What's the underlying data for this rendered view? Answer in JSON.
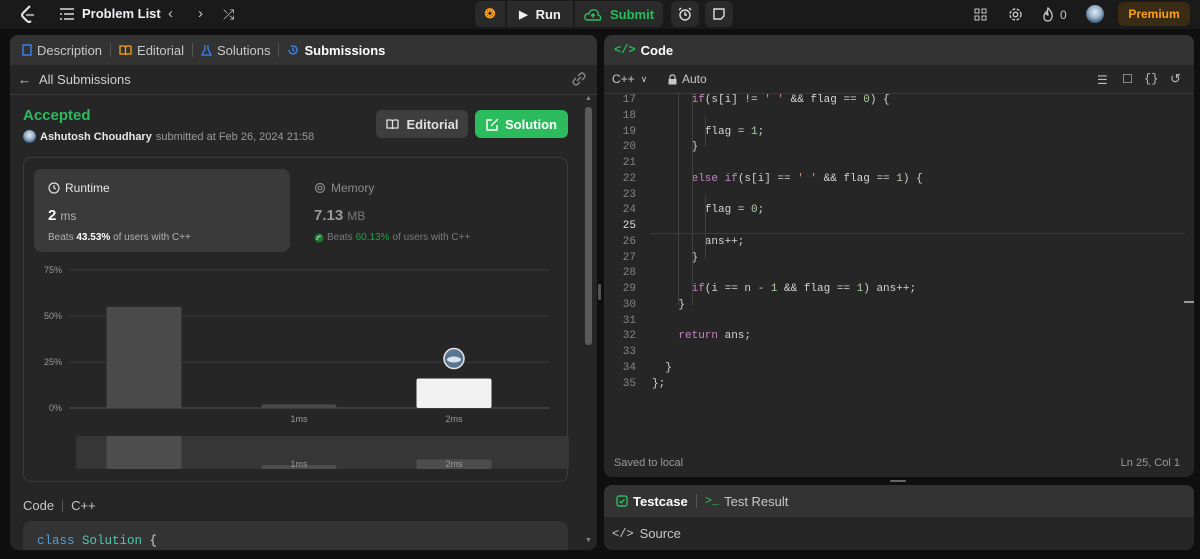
{
  "topbar": {
    "problem_list": "Problem List",
    "run": "Run",
    "submit": "Submit",
    "streak": "0",
    "premium": "Premium"
  },
  "left": {
    "tabs": [
      "Description",
      "Editorial",
      "Solutions",
      "Submissions"
    ],
    "back_label": "All Submissions",
    "status": "Accepted",
    "user": "Ashutosh Choudhary",
    "submitted_text": "submitted at Feb 26, 2024 21:58",
    "editorial_btn": "Editorial",
    "solution_btn": "Solution",
    "runtime": {
      "label": "Runtime",
      "value": "2",
      "unit": "ms",
      "beats_prefix": "Beats",
      "beats": "43.53%",
      "beats_suffix": "of users with C++"
    },
    "memory": {
      "label": "Memory",
      "value": "7.13",
      "unit": "MB",
      "beats_prefix": "Beats",
      "beats": "60.13%",
      "beats_suffix": "of users with C++"
    },
    "code_label": "Code",
    "code_lang": "C++",
    "code_preview": {
      "kw": "class",
      "name": "Solution",
      "rest": " {"
    }
  },
  "chart_data": {
    "type": "bar",
    "categories": [
      "",
      "1ms",
      "2ms"
    ],
    "values": [
      55,
      2,
      16
    ],
    "yticks": [
      "75%",
      "50%",
      "25%",
      "0%"
    ],
    "ylim": [
      0,
      75
    ],
    "highlight_index": 2,
    "overview_labels": [
      "1ms",
      "2ms"
    ]
  },
  "right": {
    "title": "Code",
    "lang": "C++",
    "mode": "Auto",
    "saved": "Saved to local",
    "cursor": "Ln 25, Col 1",
    "testcase": "Testcase",
    "test_result": "Test Result",
    "source": "Source",
    "lines": [
      {
        "n": "17",
        "parts": [
          [
            "kw",
            "if"
          ],
          [
            "",
            "(s[i] != "
          ],
          [
            "str",
            "' '"
          ],
          [
            "",
            " && flag == "
          ],
          [
            "num",
            "0"
          ],
          [
            "",
            ") {"
          ]
        ],
        "indent": 6
      },
      {
        "n": "18",
        "parts": [],
        "indent": 0
      },
      {
        "n": "19",
        "parts": [
          [
            "",
            "flag = "
          ],
          [
            "num",
            "1"
          ],
          [
            "",
            ";"
          ]
        ],
        "indent": 8
      },
      {
        "n": "20",
        "parts": [
          [
            "",
            "}"
          ]
        ],
        "indent": 6
      },
      {
        "n": "21",
        "parts": [],
        "indent": 0
      },
      {
        "n": "22",
        "parts": [
          [
            "kw",
            "else if"
          ],
          [
            "",
            "(s[i] == "
          ],
          [
            "str",
            "' '"
          ],
          [
            "",
            " && flag == "
          ],
          [
            "num",
            "1"
          ],
          [
            "",
            ") {"
          ]
        ],
        "indent": 6
      },
      {
        "n": "23",
        "parts": [],
        "indent": 0
      },
      {
        "n": "24",
        "parts": [
          [
            "",
            "flag = "
          ],
          [
            "num",
            "0"
          ],
          [
            "",
            ";"
          ]
        ],
        "indent": 8
      },
      {
        "n": "25",
        "parts": [],
        "indent": 0
      },
      {
        "n": "26",
        "parts": [
          [
            "",
            "ans++;"
          ]
        ],
        "indent": 8
      },
      {
        "n": "27",
        "parts": [
          [
            "",
            "}"
          ]
        ],
        "indent": 6
      },
      {
        "n": "28",
        "parts": [],
        "indent": 0
      },
      {
        "n": "29",
        "parts": [
          [
            "kw",
            "if"
          ],
          [
            "",
            "(i == n - "
          ],
          [
            "num",
            "1"
          ],
          [
            "",
            " && flag == "
          ],
          [
            "num",
            "1"
          ],
          [
            "",
            ") ans++;"
          ]
        ],
        "indent": 6
      },
      {
        "n": "30",
        "parts": [
          [
            "",
            "}"
          ]
        ],
        "indent": 4
      },
      {
        "n": "31",
        "parts": [],
        "indent": 0
      },
      {
        "n": "32",
        "parts": [
          [
            "kw",
            "return"
          ],
          [
            "",
            " ans;"
          ]
        ],
        "indent": 4
      },
      {
        "n": "33",
        "parts": [],
        "indent": 0
      },
      {
        "n": "34",
        "parts": [
          [
            "",
            "}"
          ]
        ],
        "indent": 2
      },
      {
        "n": "35",
        "parts": [
          [
            "",
            "};"
          ]
        ],
        "indent": 0
      }
    ]
  }
}
